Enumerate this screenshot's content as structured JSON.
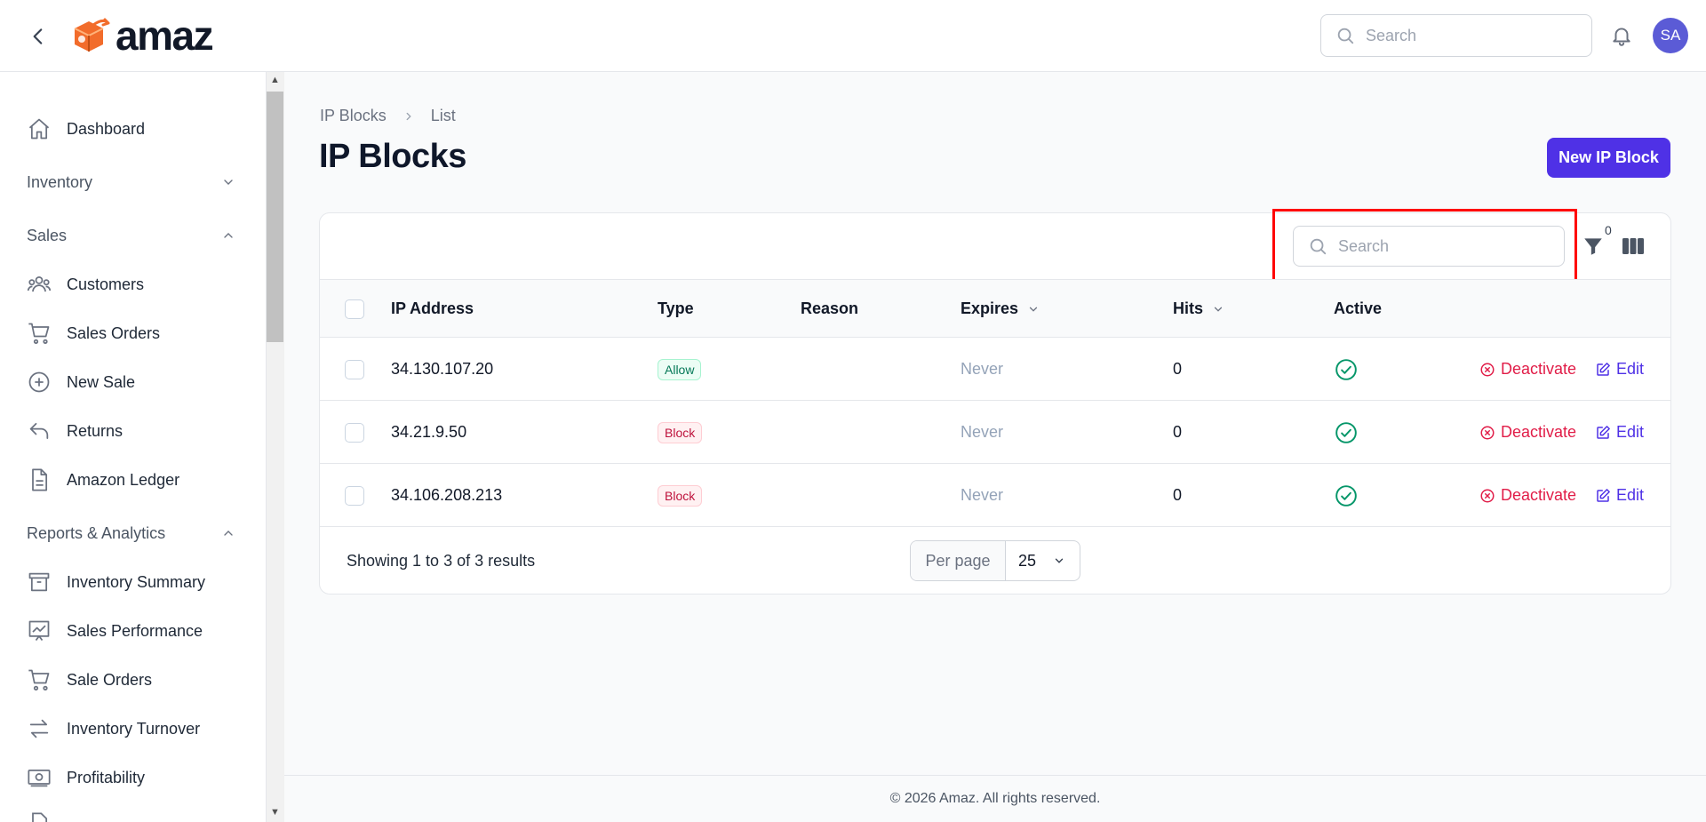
{
  "app": {
    "logo_text": "amaz"
  },
  "header": {
    "search_placeholder": "Search",
    "avatar_initials": "SA"
  },
  "sidebar": {
    "dashboard": "Dashboard",
    "inventory_group": "Inventory",
    "sales_group": "Sales",
    "customers": "Customers",
    "sales_orders": "Sales Orders",
    "new_sale": "New Sale",
    "returns": "Returns",
    "amazon_ledger": "Amazon Ledger",
    "reports_group": "Reports & Analytics",
    "inventory_summary": "Inventory Summary",
    "sales_performance": "Sales Performance",
    "sale_orders": "Sale Orders",
    "inventory_turnover": "Inventory Turnover",
    "profitability": "Profitability"
  },
  "breadcrumb": {
    "root": "IP Blocks",
    "current": "List"
  },
  "page": {
    "title": "IP Blocks",
    "new_button": "New IP Block"
  },
  "table": {
    "search_placeholder": "Search",
    "filter_count": "0",
    "columns": {
      "ip": "IP Address",
      "type": "Type",
      "reason": "Reason",
      "expires": "Expires",
      "hits": "Hits",
      "active": "Active"
    },
    "rows": [
      {
        "ip": "34.130.107.20",
        "type": "Allow",
        "reason": "",
        "expires": "Never",
        "hits": "0",
        "deactivate": "Deactivate",
        "edit": "Edit"
      },
      {
        "ip": "34.21.9.50",
        "type": "Block",
        "reason": "",
        "expires": "Never",
        "hits": "0",
        "deactivate": "Deactivate",
        "edit": "Edit"
      },
      {
        "ip": "34.106.208.213",
        "type": "Block",
        "reason": "",
        "expires": "Never",
        "hits": "0",
        "deactivate": "Deactivate",
        "edit": "Edit"
      }
    ],
    "summary": "Showing 1 to 3 of 3 results",
    "per_page_label": "Per page",
    "per_page_value": "25"
  },
  "footer": {
    "copyright": "© 2026 Amaz. All rights reserved."
  },
  "colors": {
    "primary": "#4f31e6",
    "danger": "#e11d48",
    "success": "#059669",
    "avatar": "#5b5bd6"
  }
}
